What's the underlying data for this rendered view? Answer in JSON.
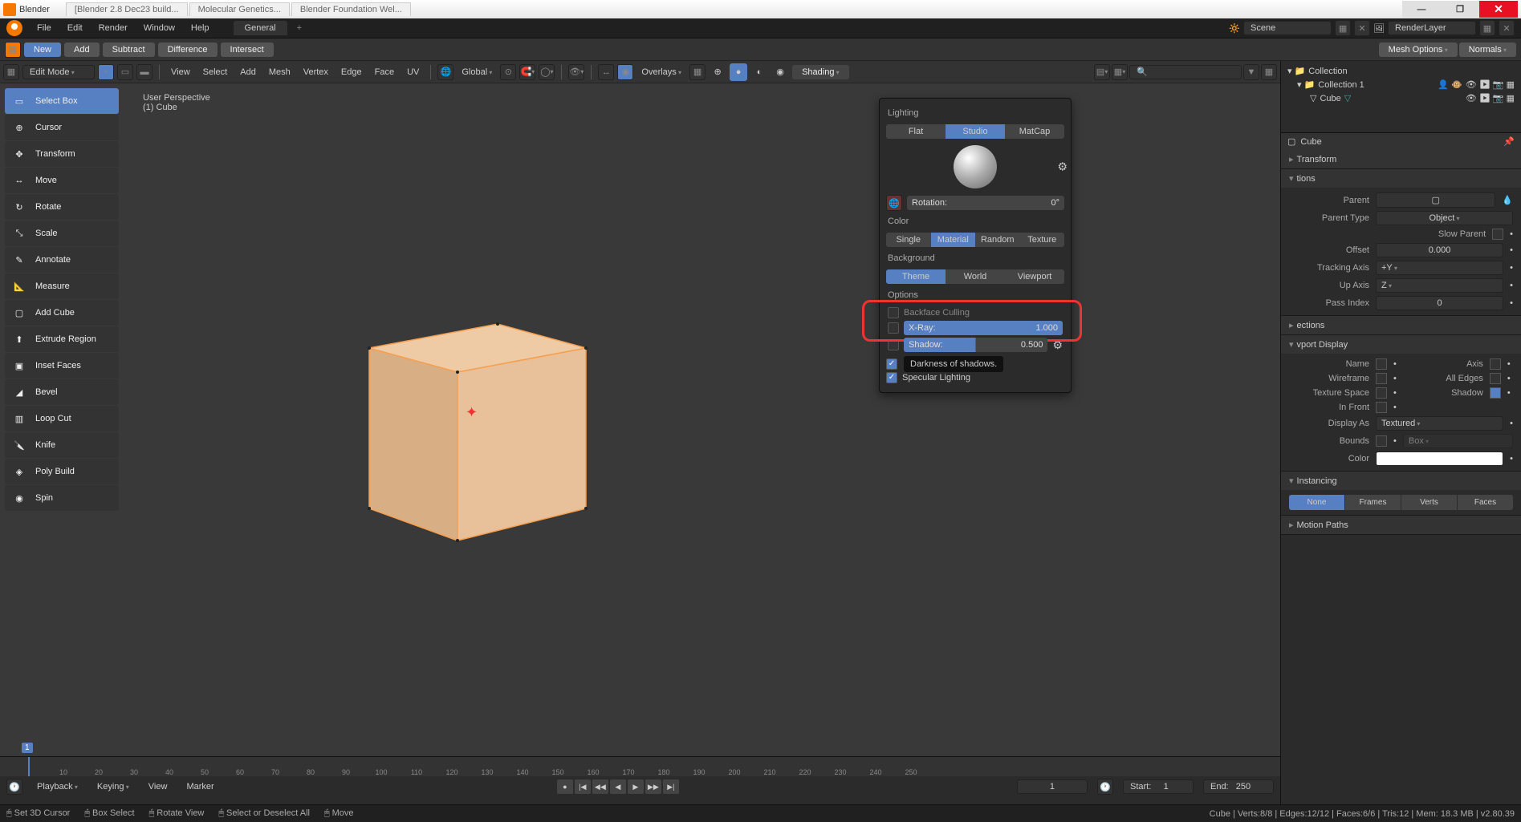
{
  "titlebar": {
    "app_name": "Blender",
    "tabs": [
      "[Blender 2.8 Dec23 build...",
      "Molecular Genetics...",
      "Blender Foundation Wel..."
    ]
  },
  "win_controls": {
    "min": "—",
    "max": "❐",
    "close": "✕"
  },
  "topmenu": {
    "file": "File",
    "edit": "Edit",
    "render": "Render",
    "window": "Window",
    "help": "Help"
  },
  "workspace": {
    "general": "General",
    "add": "+"
  },
  "scene_fields": {
    "scene": "Scene",
    "layer": "RenderLayer"
  },
  "bool_buttons": {
    "new": "New",
    "add": "Add",
    "subtract": "Subtract",
    "difference": "Difference",
    "intersect": "Intersect"
  },
  "topright_buttons": {
    "mesh_options": "Mesh Options",
    "normals": "Normals"
  },
  "vp_header": {
    "mode": "Edit Mode",
    "menus": {
      "view": "View",
      "select": "Select",
      "add": "Add",
      "mesh": "Mesh",
      "vertex": "Vertex",
      "edge": "Edge",
      "face": "Face",
      "uv": "UV"
    },
    "orientation": "Global",
    "overlays": "Overlays",
    "shading": "Shading"
  },
  "overlay_text": {
    "persp": "User Perspective",
    "obj": "(1) Cube"
  },
  "tools": [
    "Select Box",
    "Cursor",
    "Transform",
    "Move",
    "Rotate",
    "Scale",
    "Annotate",
    "Measure",
    "Add Cube",
    "Extrude Region",
    "Inset Faces",
    "Bevel",
    "Loop Cut",
    "Knife",
    "Poly Build",
    "Spin"
  ],
  "shading_popover": {
    "lighting_label": "Lighting",
    "lighting": {
      "flat": "Flat",
      "studio": "Studio",
      "matcap": "MatCap"
    },
    "rotation_label": "Rotation:",
    "rotation_value": "0°",
    "color_label": "Color",
    "color": {
      "single": "Single",
      "material": "Material",
      "random": "Random",
      "texture": "Texture"
    },
    "background_label": "Background",
    "background": {
      "theme": "Theme",
      "world": "World",
      "viewport": "Viewport"
    },
    "options_label": "Options",
    "backface": "Backface Culling",
    "xray_label": "X-Ray:",
    "xray_value": "1.000",
    "shadow_label": "Shadow:",
    "shadow_value": "0.500",
    "tooltip": "Darkness of shadows.",
    "specular": "Specular Lighting"
  },
  "outliner": {
    "collection": "Collection",
    "items": {
      "collection1": "Collection 1",
      "cube": "Cube"
    }
  },
  "props": {
    "header": "Cube",
    "transform_title": "Transform",
    "relations_title": "Relations",
    "parent_label": "Parent",
    "parent_type_label": "Parent Type",
    "parent_type": "Object",
    "slow_parent": "Slow Parent",
    "offset_label": "Offset",
    "offset": "0.000",
    "tracking_axis_label": "Tracking Axis",
    "tracking_axis": "+Y",
    "up_axis_label": "Up Axis",
    "up_axis": "Z",
    "pass_index_label": "Pass Index",
    "pass_index": "0",
    "collections_title": "Collections",
    "viewport_display_title": "Viewport Display",
    "vd": {
      "name": "Name",
      "axis": "Axis",
      "wireframe": "Wireframe",
      "all_edges": "All Edges",
      "texture_space": "Texture Space",
      "shadow": "Shadow",
      "in_front": "In Front",
      "display_as_label": "Display As",
      "display_as": "Textured",
      "bounds_label": "Bounds",
      "bounds": "Box",
      "color_label": "Color"
    },
    "instancing_title": "Instancing",
    "instancing": {
      "none": "None",
      "frames": "Frames",
      "verts": "Verts",
      "faces": "Faces"
    },
    "motion_paths_title": "Motion Paths"
  },
  "timeline": {
    "marks": [
      "10",
      "20",
      "30",
      "40",
      "50",
      "60",
      "70",
      "80",
      "90",
      "100",
      "110",
      "120",
      "130",
      "140",
      "150",
      "160",
      "170",
      "180",
      "190",
      "200",
      "210",
      "220",
      "230",
      "240",
      "250"
    ],
    "playhead_frame": "1",
    "playback": "Playback",
    "keying": "Keying",
    "view": "View",
    "marker": "Marker",
    "current": "1",
    "start_label": "Start:",
    "start": "1",
    "end_label": "End:",
    "end": "250"
  },
  "statusbar": {
    "items": [
      "Set 3D Cursor",
      "Box Select",
      "Rotate View",
      "Select or Deselect All",
      "Move"
    ],
    "right": "Cube | Verts:8/8 | Edges:12/12 | Faces:6/6 | Tris:12 | Mem: 18.3 MB | v2.80.39"
  }
}
